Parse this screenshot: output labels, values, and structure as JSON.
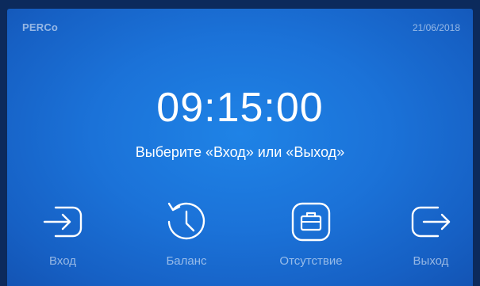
{
  "header": {
    "brand": "PERCo",
    "date": "21/06/2018"
  },
  "main": {
    "time": "09:15:00",
    "prompt": "Выберите «Вход» или «Выход»"
  },
  "actions": [
    {
      "label": "Вход",
      "icon": "enter-icon"
    },
    {
      "label": "Баланс",
      "icon": "history-clock-icon"
    },
    {
      "label": "Отсутствие",
      "icon": "briefcase-icon"
    },
    {
      "label": "Выход",
      "icon": "exit-icon"
    }
  ],
  "colors": {
    "screen_bg": "#1b72d8",
    "bezel": "#0c2a5c",
    "text": "#ffffff",
    "muted_text": "rgba(255,255,255,0.55)"
  }
}
